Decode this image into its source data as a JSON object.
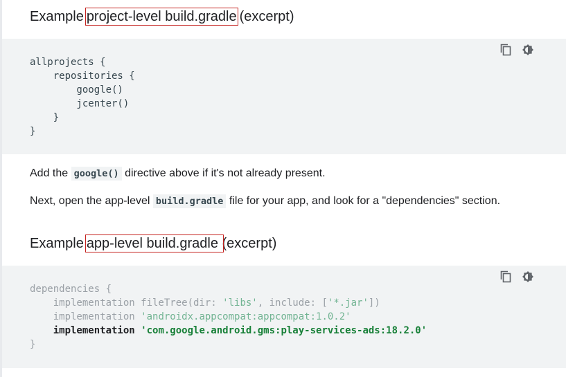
{
  "heading1": {
    "prefix": "Example",
    "highlight": "project-level build.gradle",
    "suffix": "(excerpt)"
  },
  "code1": {
    "lines": [
      "allprojects {",
      "    repositories {",
      "        google()",
      "        jcenter()",
      "    }",
      "}"
    ]
  },
  "para1": {
    "before": "Add the ",
    "code": "google()",
    "after": " directive above if it's not already present."
  },
  "para2": {
    "before": "Next, open the app-level ",
    "code": "build.gradle",
    "after": " file for your app, and look for a \"dependencies\" section."
  },
  "heading2": {
    "prefix": "Example",
    "highlight": "app-level build.gradle ",
    "suffix": "(excerpt)"
  },
  "code2": {
    "line1": "dependencies {",
    "line2_kw": "    implementation fileTree(dir: ",
    "line2_s1": "'libs'",
    "line2_mid": ", include: [",
    "line2_s2": "'*.jar'",
    "line2_end": "])",
    "line3_kw": "    implementation ",
    "line3_str": "'androidx.appcompat:appcompat:1.0.2'",
    "line4_kw": "    implementation ",
    "line4_str": "'com.google.android.gms:play-services-ads:18.2.0'",
    "line5": "}"
  },
  "icons": {
    "copy": "copy-icon",
    "theme": "dark-theme-toggle-icon"
  }
}
